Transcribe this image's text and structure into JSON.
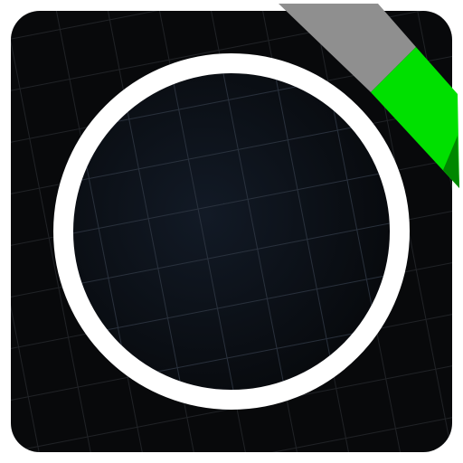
{
  "icon": {
    "name": "app-icon",
    "symbol": "circle-ring-icon"
  },
  "colors": {
    "tile_background": "#08090b",
    "grid_line": "#24272b",
    "inner_center": "#121a26",
    "inner_edge": "#07090c",
    "ring": "#ffffff",
    "ribbon_gray": "#8f8f8f",
    "ribbon_green": "#00e000",
    "ribbon_green_dark": "#007000"
  }
}
